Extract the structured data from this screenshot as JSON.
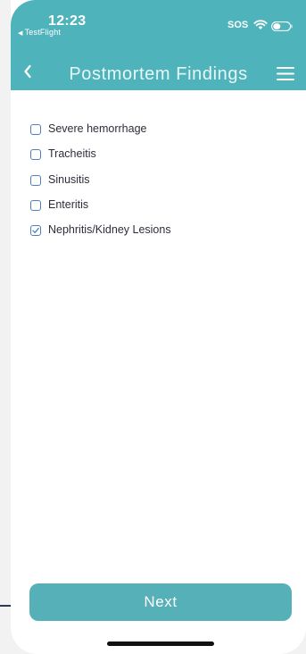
{
  "status_bar": {
    "time": "12:23",
    "back_app": "TestFlight",
    "sos": "SOS"
  },
  "nav": {
    "title": "Postmortem Findings",
    "back_icon": "chevron-left-icon",
    "menu_icon": "hamburger-menu-icon"
  },
  "checklist": {
    "items": [
      {
        "label": "Severe hemorrhage",
        "checked": false
      },
      {
        "label": "Tracheitis",
        "checked": false
      },
      {
        "label": "Sinusitis",
        "checked": false
      },
      {
        "label": "Enteritis",
        "checked": false
      },
      {
        "label": "Nephritis/Kidney Lesions",
        "checked": true
      }
    ]
  },
  "footer": {
    "next_label": "Next"
  },
  "colors": {
    "accent": "#4fb3bb",
    "button": "#56b0b8",
    "checkbox_border": "#4f7fb8"
  }
}
